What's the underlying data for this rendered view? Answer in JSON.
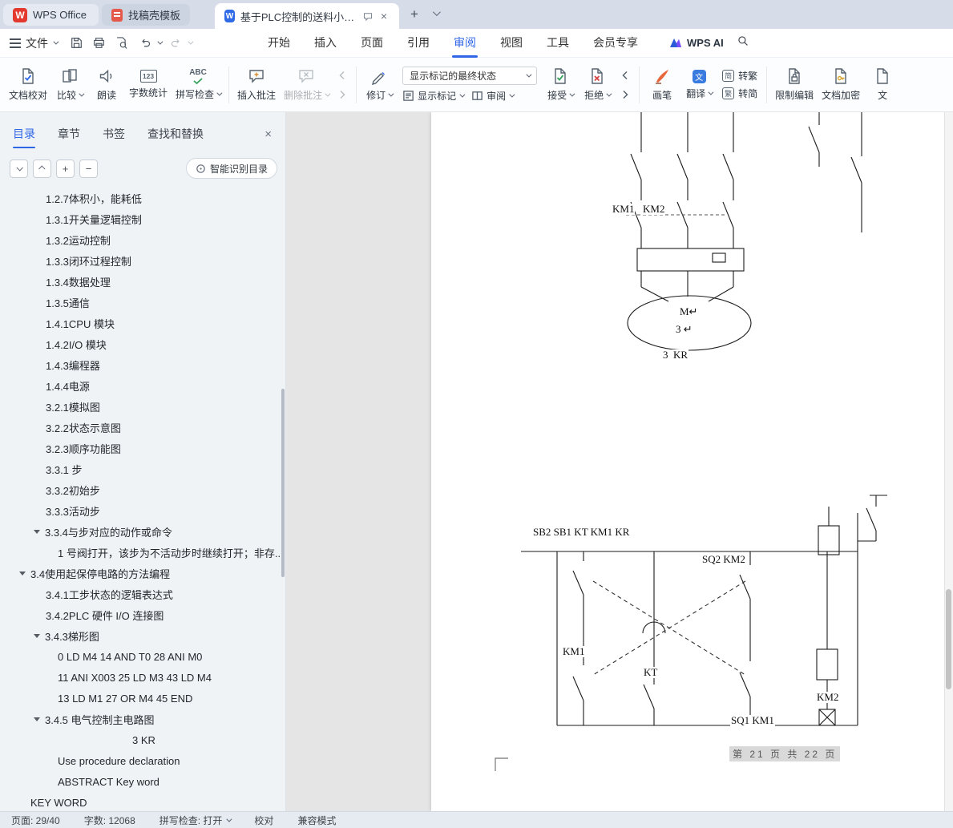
{
  "icons": {
    "wps_w": "W",
    "word_w": "W",
    "close": "×",
    "plus": "+",
    "minus": "−",
    "new_tab": "+",
    "word_count_glyph": "123",
    "spellcheck_glyph": "ABC",
    "simp_glyph": "简",
    "trad_glyph": "繁",
    "translate_glyph": "文"
  },
  "tabbar": {
    "tabs": [
      {
        "label": "WPS Office"
      },
      {
        "label": "找稿壳模板"
      },
      {
        "label": "基于PLC控制的送料小车控制系"
      }
    ]
  },
  "menubar": {
    "file_label": "文件",
    "tabs": [
      "开始",
      "插入",
      "页面",
      "引用",
      "审阅",
      "视图",
      "工具",
      "会员专享"
    ],
    "active_tab": "审阅",
    "wps_ai": "WPS AI"
  },
  "ribbon": {
    "doc_proof": "文档校对",
    "compare": "比较",
    "read_aloud": "朗读",
    "word_count": "字数统计",
    "spell_check": "拼写检查",
    "insert_comment": "插入批注",
    "delete_comment": "删除批注",
    "track_changes": "修订",
    "markup_state": "显示标记的最终状态",
    "show_markup": "显示标记",
    "review_pane": "审阅",
    "accept": "接受",
    "reject": "拒绝",
    "pen": "画笔",
    "translate": "翻译",
    "to_trad": "转繁",
    "to_simp": "转简",
    "restrict_edit": "限制编辑",
    "encrypt": "文档加密",
    "cutoff": "文"
  },
  "sidebar": {
    "tabs": [
      "目录",
      "章节",
      "书签",
      "查找和替换"
    ],
    "active_tab": "目录",
    "smart_toc": "智能识别目录",
    "toc": [
      {
        "label": "1.2.7体积小，能耗低"
      },
      {
        "label": "1.3.1开关量逻辑控制"
      },
      {
        "label": "1.3.2运动控制"
      },
      {
        "label": "1.3.3闭环过程控制"
      },
      {
        "label": "1.3.4数据处理"
      },
      {
        "label": "1.3.5通信"
      },
      {
        "label": "1.4.1CPU 模块"
      },
      {
        "label": "1.4.2I/O 模块"
      },
      {
        "label": "1.4.3编程器"
      },
      {
        "label": "1.4.4电源"
      },
      {
        "label": "3.2.1模拟图"
      },
      {
        "label": "3.2.2状态示意图"
      },
      {
        "label": "3.2.3顺序功能图"
      },
      {
        "label": "3.3.1 步"
      },
      {
        "label": "3.3.2初始步"
      },
      {
        "label": "3.3.3活动步"
      },
      {
        "label": "3.3.4与步对应的动作或命令"
      },
      {
        "label": "1 号阀打开，该步为不活动步时继续打开；非存..."
      },
      {
        "label": "3.4使用起保停电路的方法编程"
      },
      {
        "label": "3.4.1工步状态的逻辑表达式"
      },
      {
        "label": "3.4.2PLC 硬件 I/O 连接图"
      },
      {
        "label": "3.4.3梯形图"
      },
      {
        "label": "0 LD M4 14 AND T0 28 ANI M0"
      },
      {
        "label": "11 ANI X003 25 LD M3 43 LD M4"
      },
      {
        "label": "13 LD M1 27 OR M4 45 END"
      },
      {
        "label": "3.4.5 电气控制主电路图"
      },
      {
        "label": "3 KR"
      },
      {
        "label": "Use procedure declaration"
      },
      {
        "label": "ABSTRACT Key word"
      },
      {
        "label": "KEY WORD"
      }
    ]
  },
  "document": {
    "diagram1": {
      "km1": "KM1",
      "km2": "KM2",
      "motor_m": "M↵",
      "motor_3": "3 ↵",
      "kr": "3  KR"
    },
    "diagram2": {
      "top_labels": "SB2 SB1 KT KM1 KR",
      "sq2_km2": "SQ2 KM2",
      "km1": "KM1",
      "kt": "KT",
      "km2": "KM2",
      "sq1_km1": "SQ1 KM1"
    },
    "footer": "第 21 页 共 22 页"
  },
  "statusbar": {
    "page": "页面: 29/40",
    "words": "字数: 12068",
    "spell": "拼写检查: 打开",
    "proof": "校对",
    "mode": "兼容模式"
  }
}
